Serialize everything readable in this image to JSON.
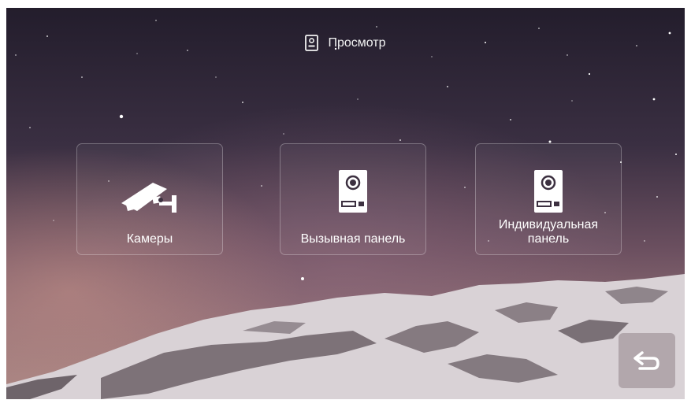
{
  "header": {
    "title": "Просмотр",
    "icon": "door-panel-icon"
  },
  "tiles": [
    {
      "label": "Камеры",
      "icon": "cctv-camera-icon"
    },
    {
      "label": "Вызывная панель",
      "icon": "door-panel-icon"
    },
    {
      "label": "Индивидуальная панель",
      "icon": "door-panel-icon"
    }
  ],
  "back_button": {
    "icon": "back-arrow-icon"
  }
}
